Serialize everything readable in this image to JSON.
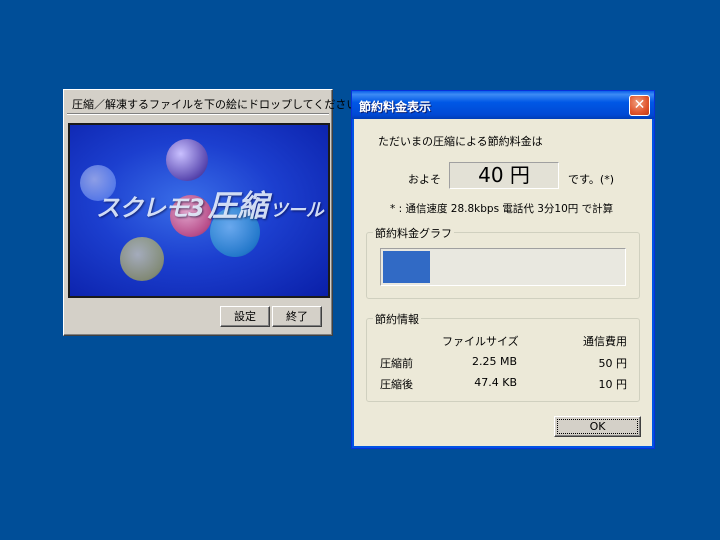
{
  "drop_window": {
    "title": "圧縮／解凍するファイルを下の絵にドロップしてください",
    "logo_part1": "スクレモ3",
    "logo_part2": "圧縮",
    "logo_part3": "ツール",
    "settings_label": "設定",
    "exit_label": "終了"
  },
  "savings_dialog": {
    "title": "節約料金表示",
    "intro": "ただいまの圧縮による節約料金は",
    "approx_label": "およそ",
    "amount": "40 円",
    "amount_suffix": "です。(*)",
    "rate_note": "* : 通信速度 28.8kbps 電話代 3分10円 で計算",
    "graph_label": "節約料金グラフ",
    "graph_fraction": 0.2,
    "info_label": "節約情報",
    "info_headers": [
      "",
      "ファイルサイズ",
      "通信費用"
    ],
    "info_rows": [
      {
        "label": "圧縮前",
        "size": "2.25 MB",
        "cost": "50 円"
      },
      {
        "label": "圧縮後",
        "size": "47.4 KB",
        "cost": "10 円"
      }
    ],
    "ok_label": "OK"
  },
  "colors": {
    "desktop": "#004e98",
    "titlebar": "#0058e6",
    "graph_fill": "#316ac5",
    "close": "#e0542c"
  },
  "icons": {
    "close": "close-icon"
  }
}
